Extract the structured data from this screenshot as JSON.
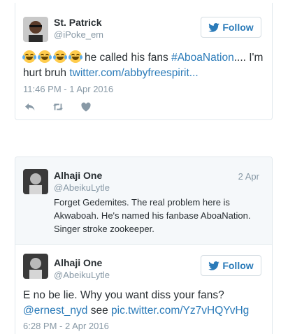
{
  "tweet1": {
    "name": "St. Patrick",
    "handle": "@iPoke_em",
    "follow_label": "Follow",
    "text_pre": "he called his fans ",
    "hashtag": "#AbоaNation",
    "text_mid": ".... I'm hurt bruh ",
    "link": "twitter.com/abbyfreespirit...",
    "timestamp": "11:46 PM - 1 Apr 2016",
    "emoji_icon": "face-with-tears-of-joy",
    "actions": [
      "reply-icon",
      "retweet-icon",
      "like-icon"
    ]
  },
  "tweet2": {
    "quoted": {
      "name": "Alhaji One",
      "handle": "@AbeikuLytle",
      "date": "2 Apr",
      "line1": "Forget Gedemites. The real problem here is",
      "line2": "Akwaboah. He's named his fanbase AboaNation.",
      "line3": "Singer stroke zookeeper."
    },
    "name": "Alhaji One",
    "handle": "@AbeikuLytle",
    "follow_label": "Follow",
    "line1": "E no be lie. Why you want diss your fans?",
    "mention": "@ernest_nyd",
    "see": " see ",
    "pic_link": "pic.twitter.com/Yz7vHQYvHg",
    "timestamp": "6:28 PM - 2 Apr 2016"
  },
  "colors": {
    "link": "#2b7bb9",
    "muted": "#8899a6",
    "border": "#e1e8ed"
  }
}
